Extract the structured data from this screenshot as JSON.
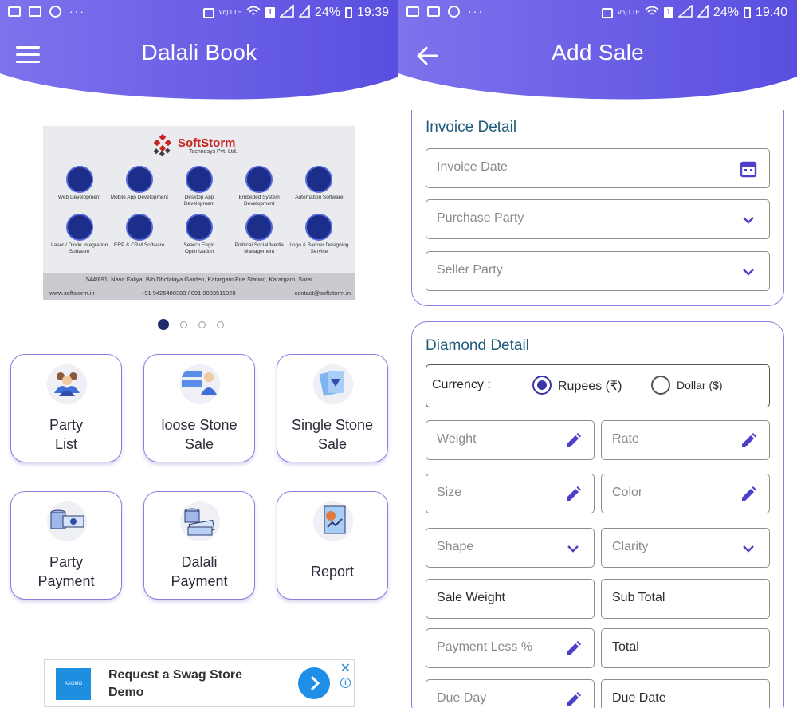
{
  "status_left": {
    "time": "19:39",
    "battery": "24%",
    "network": "Vo) LTE",
    "sim": "1",
    "dots": "···"
  },
  "status_right": {
    "time": "19:40",
    "battery": "24%",
    "network": "Vo) LTE",
    "sim": "1",
    "dots": "···"
  },
  "colors": {
    "header_gradient_start": "#7d73ec",
    "header_gradient_end": "#5a4ee0",
    "accent": "#4c3fc8",
    "card_border": "#8a7fe0",
    "section_title": "#1f5b7a"
  },
  "home": {
    "title": "Dalali Book",
    "menu_icon": "hamburger-menu-icon",
    "banner": {
      "company": "SoftStorm",
      "company_sub": "Technosys Pvt. Ltd.",
      "services": [
        {
          "label": "Web Development",
          "icon": "web-development-icon"
        },
        {
          "label": "Mobile App Development",
          "icon": "mobile-app-icon"
        },
        {
          "label": "Desktop App Development",
          "icon": "desktop-app-icon"
        },
        {
          "label": "Embeded System Development",
          "icon": "chip-icon"
        },
        {
          "label": "Automation Software",
          "icon": "automation-icon"
        },
        {
          "label": "Laser / Diode Integration Software",
          "icon": "laser-icon"
        },
        {
          "label": "ERP & CRM Software",
          "icon": "erp-icon"
        },
        {
          "label": "Search Engin Optimization",
          "icon": "seo-icon"
        },
        {
          "label": "Political Social Media Management",
          "icon": "social-media-icon"
        },
        {
          "label": "Logo & Banner Designing Service",
          "icon": "design-icon"
        }
      ],
      "address": "544/691, Nava Faliya, B/h Dholakiya Garden, Katargam Fire Station, Katargam, Surat",
      "website": "www.softstorm.in",
      "phone": "+91 9426480383 / 091 9033511028",
      "email": "contact@softstorm.in"
    },
    "carousel_pages": 4,
    "carousel_active": 1,
    "tiles": [
      {
        "line1": "Party",
        "line2": "List",
        "icon": "party-list-icon"
      },
      {
        "line1": "loose Stone",
        "line2": "Sale",
        "icon": "loose-stone-sale-icon"
      },
      {
        "line1": "Single Stone",
        "line2": "Sale",
        "icon": "single-stone-sale-icon"
      },
      {
        "line1": "Party",
        "line2": "Payment",
        "icon": "party-payment-icon"
      },
      {
        "line1": "Dalali",
        "line2": "Payment",
        "icon": "dalali-payment-icon"
      },
      {
        "line1": "Report",
        "line2": "",
        "icon": "report-icon"
      }
    ],
    "ad": {
      "text": "Request a Swag Store Demo",
      "logo_text": "AXOMO",
      "close": "✕",
      "info": "i"
    }
  },
  "add_sale": {
    "title": "Add Sale",
    "back_icon": "back-arrow-icon",
    "invoice_section": {
      "title": "Invoice Detail",
      "invoice_date_placeholder": "Invoice Date",
      "purchase_party_placeholder": "Purchase Party",
      "seller_party_placeholder": "Seller Party"
    },
    "diamond_section": {
      "title": "Diamond Detail",
      "currency_label": "Currency :",
      "currency_options": [
        {
          "label": "Rupees (₹)",
          "selected": true
        },
        {
          "label": "Dollar ($)",
          "selected": false
        }
      ],
      "fields": {
        "weight": "Weight",
        "rate": "Rate",
        "size": "Size",
        "color": "Color",
        "shape": "Shape",
        "clarity": "Clarity",
        "sale_weight": "Sale Weight",
        "sub_total": "Sub Total",
        "payment_less": "Payment Less %",
        "total": "Total",
        "due_day": "Due Day",
        "due_date": "Due Date"
      }
    }
  }
}
